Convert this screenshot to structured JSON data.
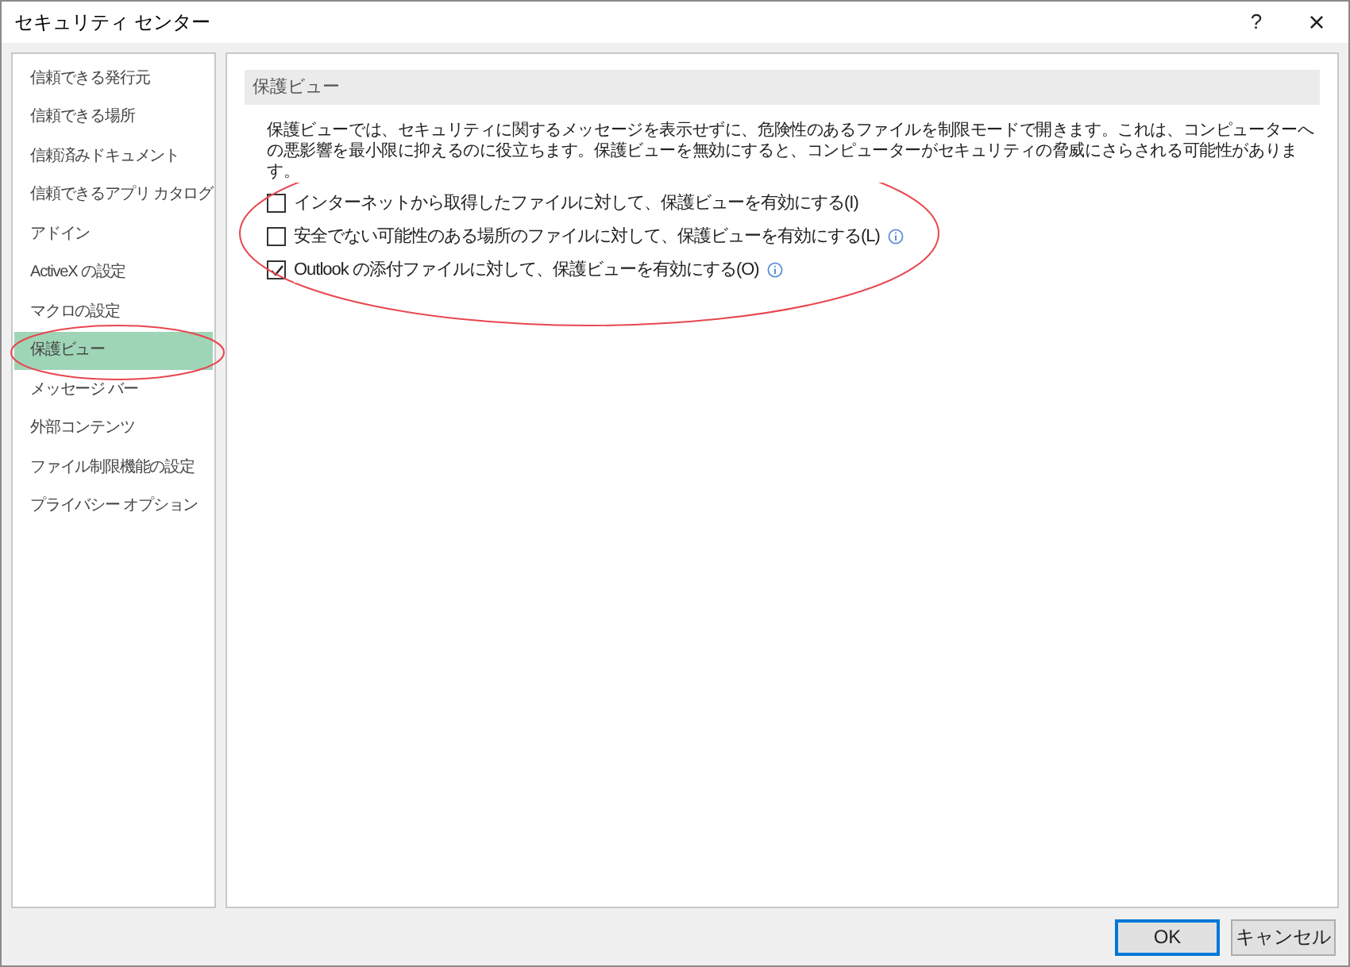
{
  "window": {
    "title": "セキュリティ センター",
    "help": "?",
    "close": "×"
  },
  "sidebar": {
    "items": [
      {
        "label": "信頼できる発行元",
        "selected": false
      },
      {
        "label": "信頼できる場所",
        "selected": false
      },
      {
        "label": "信頼済みドキュメント",
        "selected": false
      },
      {
        "label": "信頼できるアプリ カタログ",
        "selected": false
      },
      {
        "label": "アドイン",
        "selected": false
      },
      {
        "label": "ActiveX の設定",
        "selected": false
      },
      {
        "label": "マクロの設定",
        "selected": false
      },
      {
        "label": "保護ビュー",
        "selected": true
      },
      {
        "label": "メッセージ バー",
        "selected": false
      },
      {
        "label": "外部コンテンツ",
        "selected": false
      },
      {
        "label": "ファイル制限機能の設定",
        "selected": false
      },
      {
        "label": "プライバシー オプション",
        "selected": false
      }
    ]
  },
  "section": {
    "title": "保護ビュー",
    "description": "保護ビューでは、セキュリティに関するメッセージを表示せずに、危険性のあるファイルを制限モードで開きます。これは、コンピューターへの悪影響を最小限に抑えるのに役立ちます。保護ビューを無効にすると、コンピューターがセキュリティの脅威にさらされる可能性があります。",
    "options": [
      {
        "label": "インターネットから取得したファイルに対して、保護ビューを有効にする(I)",
        "checked": false,
        "info": false
      },
      {
        "label": "安全でない可能性のある場所のファイルに対して、保護ビューを有効にする(L)",
        "checked": false,
        "info": true
      },
      {
        "label": "Outlook の添付ファイルに対して、保護ビューを有効にする(O)",
        "checked": true,
        "info": true
      }
    ]
  },
  "buttons": [
    {
      "label": "OK",
      "default": true
    },
    {
      "label": "キャンセル",
      "default": false
    }
  ]
}
